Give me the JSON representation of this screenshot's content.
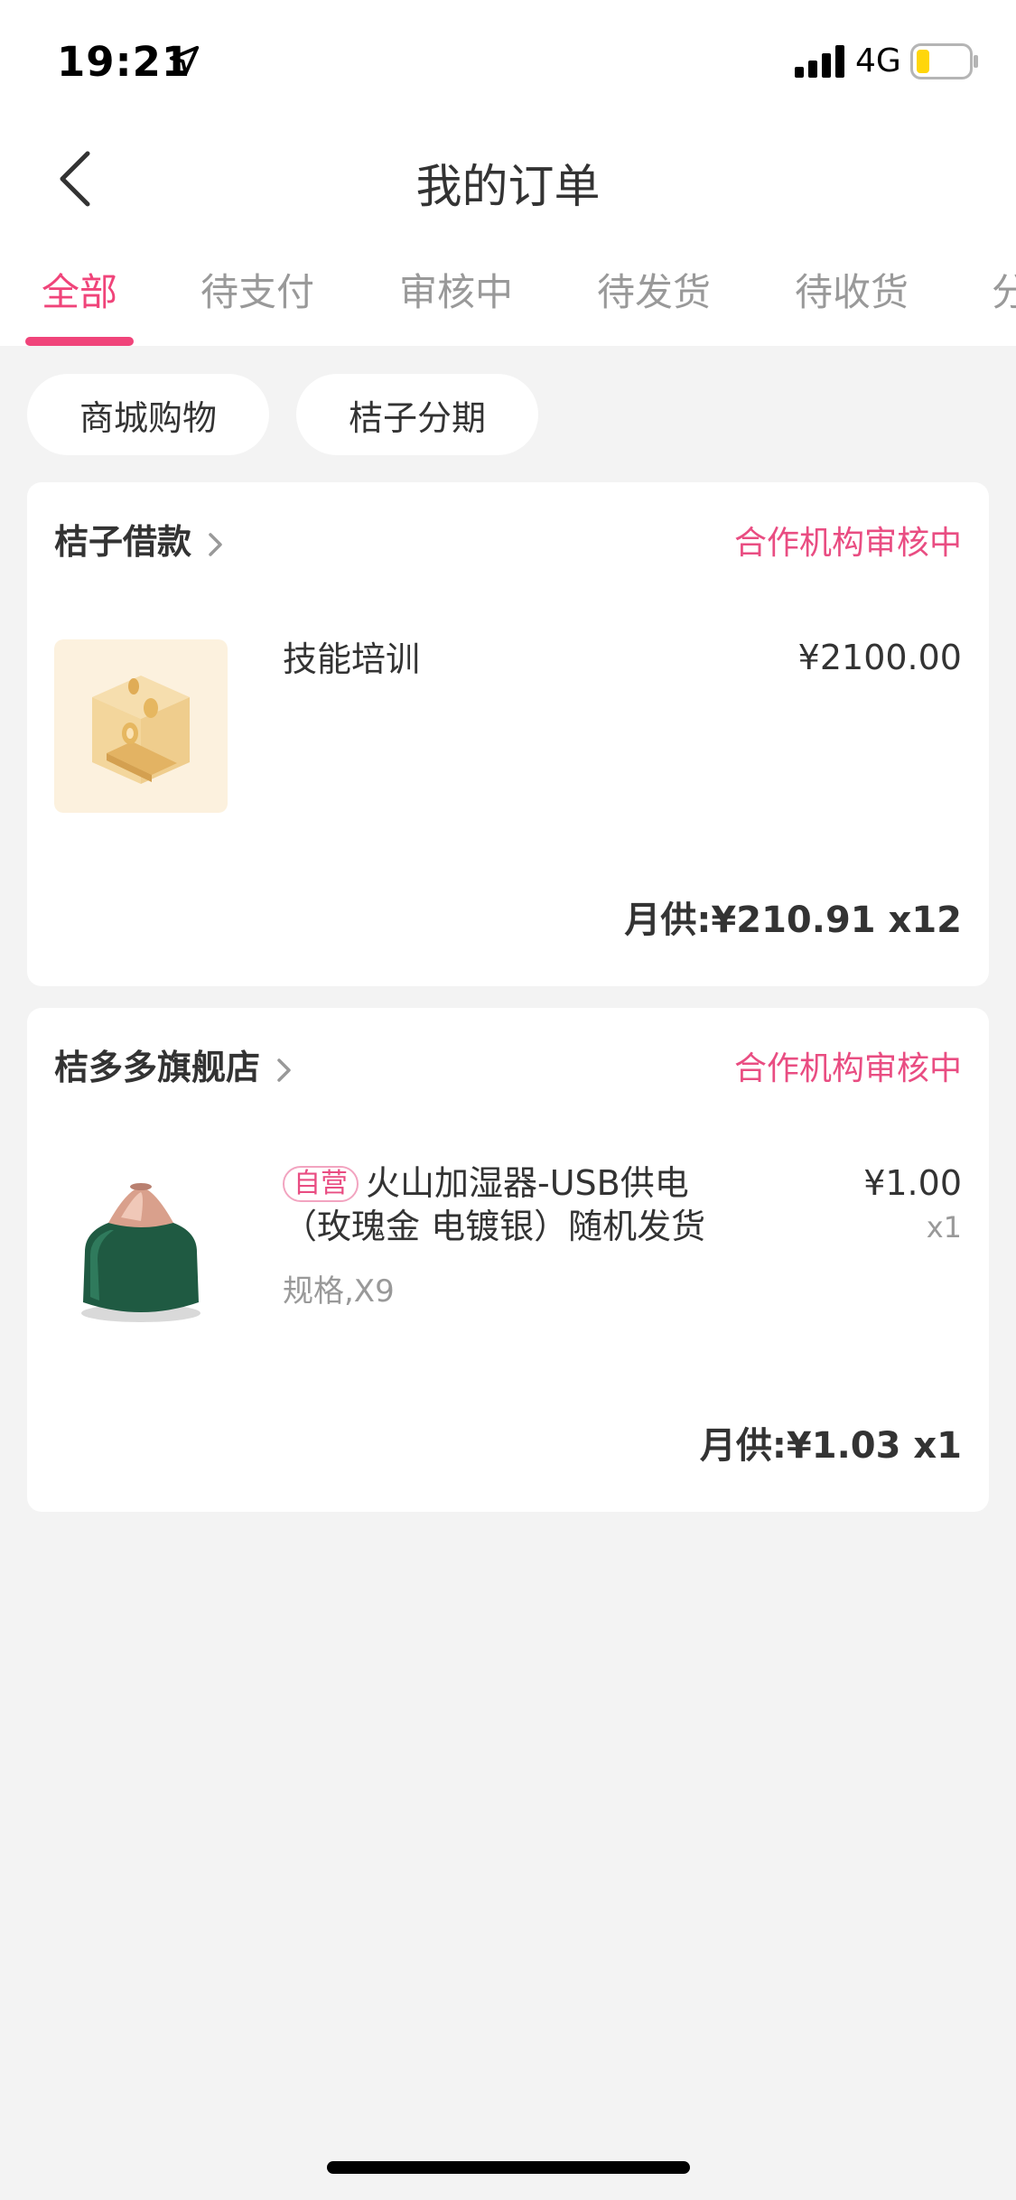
{
  "status_bar": {
    "time": "19:21",
    "network": "4G",
    "location_icon": "location-arrow-icon",
    "signal_icon": "signal-bars-icon",
    "battery_icon": "battery-low-icon"
  },
  "nav": {
    "title": "我的订单",
    "back_icon": "chevron-left-icon"
  },
  "tabs": [
    {
      "label": "全部",
      "active": true
    },
    {
      "label": "待支付",
      "active": false
    },
    {
      "label": "审核中",
      "active": false
    },
    {
      "label": "待发货",
      "active": false
    },
    {
      "label": "待收货",
      "active": false
    },
    {
      "label": "分",
      "active": false
    }
  ],
  "filters": [
    {
      "label": "商城购物"
    },
    {
      "label": "桔子分期"
    }
  ],
  "orders": [
    {
      "store": "桔子借款",
      "status": "合作机构审核中",
      "item": {
        "title": "技能培训",
        "price": "¥2100.00"
      },
      "monthly": "月供:¥210.91 x12"
    },
    {
      "store": "桔多多旗舰店",
      "status": "合作机构审核中",
      "item": {
        "badge": "自营",
        "title_line1": "火山加湿器-USB供电",
        "title_line2": "（玫瑰金 电镀银）随机发货",
        "spec": "规格,X9",
        "price": "¥1.00",
        "qty": "x1"
      },
      "monthly": "月供:¥1.03 x1"
    }
  ],
  "colors": {
    "accent": "#f0447a",
    "status_pink": "#e94d82",
    "background": "#f3f3f3"
  }
}
